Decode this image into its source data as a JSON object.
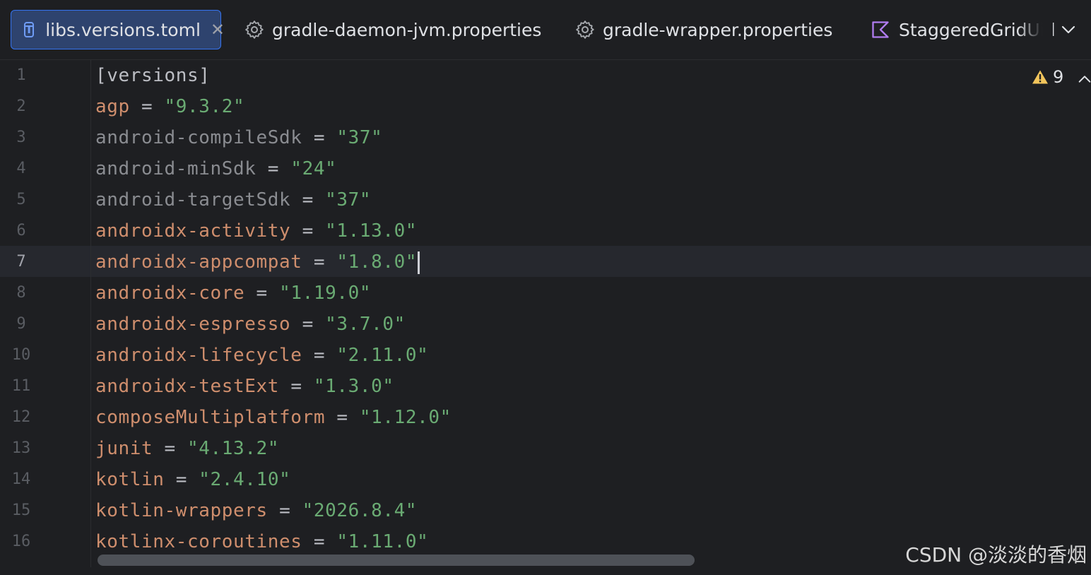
{
  "tabs": [
    {
      "label": "libs.versions.toml",
      "icon": "toml-file-icon",
      "active": true,
      "closable": true
    },
    {
      "label": "gradle-daemon-jvm.properties",
      "icon": "gear-icon",
      "active": false
    },
    {
      "label": "gradle-wrapper.properties",
      "icon": "gear-icon",
      "active": false
    },
    {
      "label": "StaggeredGridUi.l",
      "icon": "kotlin-file-icon",
      "active": false
    }
  ],
  "tab_close_symbol": "✕",
  "editor": {
    "current_line": 7,
    "warnings_count": "9",
    "lines": [
      {
        "num": "1",
        "section": "[versions]"
      },
      {
        "num": "2",
        "key": "agp",
        "value": "\"9.3.2\""
      },
      {
        "num": "3",
        "key": "android-compileSdk",
        "value": "\"37\""
      },
      {
        "num": "4",
        "key": "android-minSdk",
        "value": "\"24\""
      },
      {
        "num": "5",
        "key": "android-targetSdk",
        "value": "\"37\""
      },
      {
        "num": "6",
        "key": "androidx-activity",
        "value": "\"1.13.0\""
      },
      {
        "num": "7",
        "key": "androidx-appcompat",
        "value": "\"1.8.0\""
      },
      {
        "num": "8",
        "key": "androidx-core",
        "value": "\"1.19.0\""
      },
      {
        "num": "9",
        "key": "androidx-espresso",
        "value": "\"3.7.0\""
      },
      {
        "num": "10",
        "key": "androidx-lifecycle",
        "value": "\"2.11.0\""
      },
      {
        "num": "11",
        "key": "androidx-testExt",
        "value": "\"1.3.0\""
      },
      {
        "num": "12",
        "key": "composeMultiplatform",
        "value": "\"1.12.0\""
      },
      {
        "num": "13",
        "key": "junit",
        "value": "\"4.13.2\""
      },
      {
        "num": "14",
        "key": "kotlin",
        "value": "\"2.4.10\""
      },
      {
        "num": "15",
        "key": "kotlin-wrappers",
        "value": "\"2026.8.4\""
      },
      {
        "num": "16",
        "key": "kotlinx-coroutines",
        "value": "\"1.11.0\""
      }
    ]
  },
  "watermark": "CSDN @淡淡的香烟",
  "colors": {
    "background": "#1e1f22",
    "key": "#cf8e6d",
    "unused_key": "#8a8c91",
    "string": "#6aab73",
    "active_tab_bg": "#2e436e",
    "active_tab_border": "#3574f0",
    "warning": "#f2c55c"
  }
}
